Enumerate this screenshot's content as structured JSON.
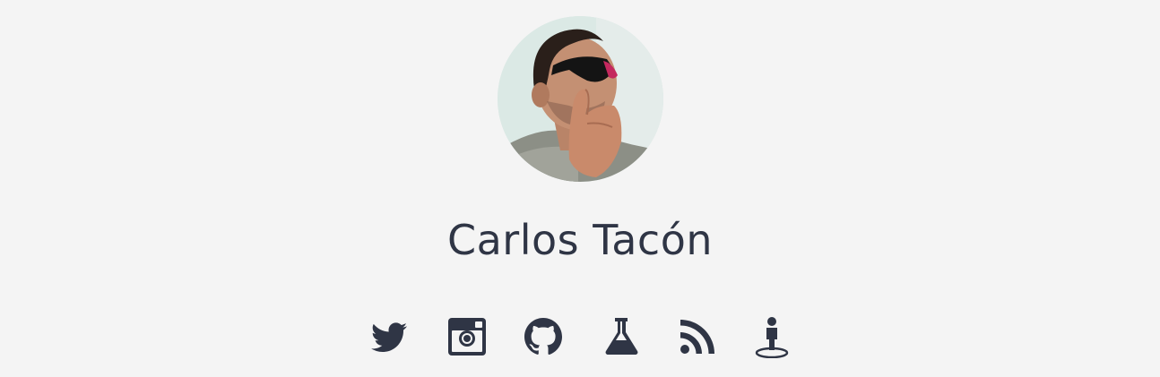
{
  "profile": {
    "name": "Carlos Tacón",
    "avatar_icon": "profile-photo"
  },
  "social": [
    {
      "icon": "twitter-icon"
    },
    {
      "icon": "instagram-icon"
    },
    {
      "icon": "github-icon"
    },
    {
      "icon": "lab-flask-icon"
    },
    {
      "icon": "rss-icon"
    },
    {
      "icon": "person-location-icon"
    }
  ],
  "colors": {
    "background": "#f4f4f4",
    "text": "#2f3545",
    "icon": "#2f3545"
  }
}
